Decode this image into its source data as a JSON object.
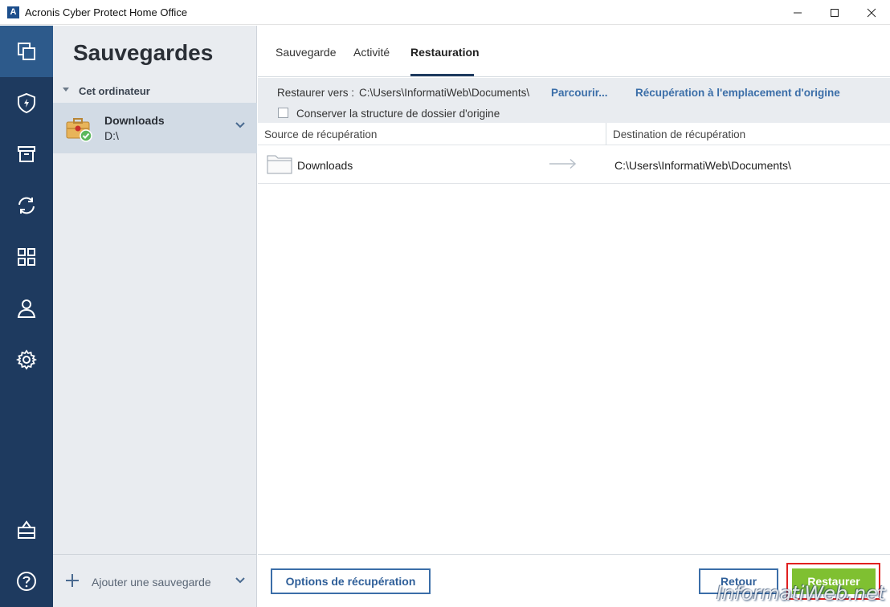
{
  "window": {
    "title": "Acronis Cyber Protect Home Office",
    "logo_letter": "A"
  },
  "sidebar": {
    "title": "Sauvegardes",
    "group_label": "Cet ordinateur",
    "backup": {
      "name": "Downloads",
      "path": "D:\\"
    },
    "add_label": "Ajouter une sauvegarde"
  },
  "tabs": [
    {
      "label": "Sauvegarde"
    },
    {
      "label": "Activité"
    },
    {
      "label": "Restauration"
    }
  ],
  "restore": {
    "to_label": "Restaurer vers :",
    "to_path": "C:\\Users\\InformatiWeb\\Documents\\",
    "browse_label": "Parcourir...",
    "original_location_label": "Récupération à l'emplacement d'origine",
    "keep_structure_label": "Conserver la structure de dossier d'origine"
  },
  "grid": {
    "source_header": "Source de récupération",
    "dest_header": "Destination de récupération",
    "rows": [
      {
        "source": "Downloads",
        "destination": "C:\\Users\\InformatiWeb\\Documents\\"
      }
    ]
  },
  "footer": {
    "options_label": "Options de récupération",
    "back_label": "Retour",
    "restore_label": "Restaurer"
  },
  "watermark": "InformatiWeb.net",
  "colors": {
    "rail": "#1e3a5f",
    "accent": "#3b6ea8",
    "restore_button": "#7fc031"
  }
}
